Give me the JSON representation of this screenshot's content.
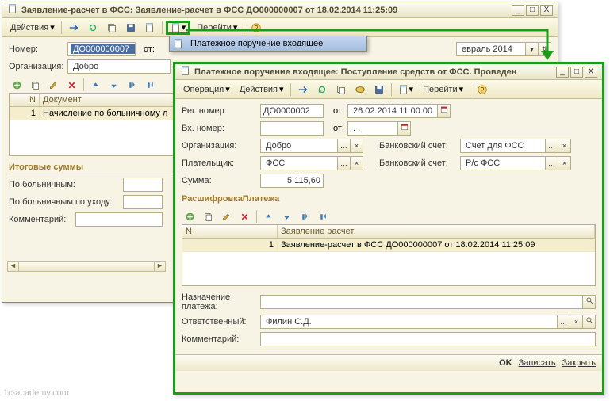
{
  "watermark": "1c-academy.com",
  "win1": {
    "title": "Заявление-расчет в ФСС: Заявление-расчет в ФСС ДО000000007 от 18.02.2014 11:25:09",
    "toolbar": {
      "actions": "Действия",
      "goto": "Перейти"
    },
    "fields": {
      "number_lbl": "Номер:",
      "number_val": "ДО000000007",
      "from_lbl": "от:",
      "date_frag": "евраль 2014",
      "org_lbl": "Организация:",
      "org_val": "Добро"
    },
    "grid": {
      "col_n": "N",
      "col_doc": "Документ",
      "row1_n": "1",
      "row1_doc": "Начисление по больничному л"
    },
    "sums": {
      "title": "Итоговые суммы",
      "sick_lbl": "По больничным:",
      "sick_care_lbl": "По больничным по уходу:",
      "comment_lbl": "Комментарий:"
    },
    "dropdown_item": "Платежное поручение входящее"
  },
  "win2": {
    "title": "Платежное поручение входящее: Поступление средств от ФСС. Проведен",
    "toolbar": {
      "operation": "Операция",
      "actions": "Действия",
      "goto": "Перейти"
    },
    "fields": {
      "regnum_lbl": "Рег. номер:",
      "regnum_val": "ДО0000002",
      "from_lbl": "от:",
      "date_val": "26.02.2014 11:00:00",
      "inum_lbl": "Вх. номер:",
      "inum_val": "",
      "idate_val": ". .",
      "org_lbl": "Организация:",
      "org_val": "Добро",
      "bank1_lbl": "Банковский счет:",
      "bank1_val": "Счет для ФСС",
      "payer_lbl": "Плательщик:",
      "payer_val": "ФСС",
      "bank2_lbl": "Банковский счет:",
      "bank2_val": "Р/с  ФСС",
      "sum_lbl": "Сумма:",
      "sum_val": "5 115,60"
    },
    "section": "РасшифровкаПлатежа",
    "grid": {
      "col_n": "N",
      "col_decl": "Заявление расчет",
      "row1_n": "1",
      "row1_decl": "Заявление-расчет в ФСС ДО000000007 от 18.02.2014 11:25:09"
    },
    "bottom": {
      "purpose_lbl": "Назначение платежа:",
      "resp_lbl": "Ответственный:",
      "resp_val": "Филин С.Д.",
      "comment_lbl": "Комментарий:"
    },
    "footer": {
      "ok": "OK",
      "save": "Записать",
      "close": "Закрыть"
    }
  }
}
